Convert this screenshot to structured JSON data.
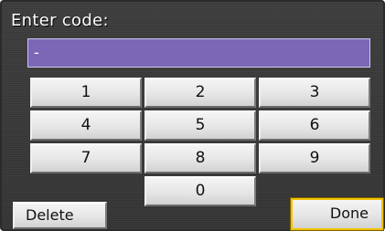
{
  "prompt": {
    "label": "Enter code:"
  },
  "code_input": {
    "value": "-"
  },
  "keypad": {
    "keys": [
      "1",
      "2",
      "3",
      "4",
      "5",
      "6",
      "7",
      "8",
      "9",
      "0"
    ]
  },
  "actions": {
    "delete_label": "Delete",
    "done_label": "Done"
  },
  "colors": {
    "input_background": "#7b67b5",
    "focus_highlight": "#f2c200",
    "screen_background": "#3a3a3a"
  }
}
